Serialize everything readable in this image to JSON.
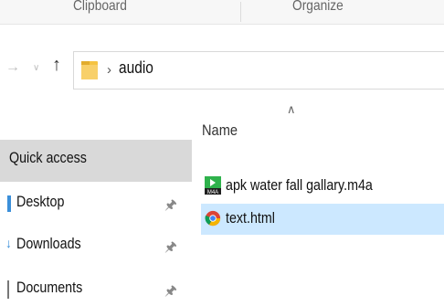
{
  "ribbon": {
    "groups": [
      "Clipboard",
      "Organize"
    ]
  },
  "navigation": {
    "back_icon": "back-arrow-icon",
    "recent_icon": "chevron-down-icon",
    "up_icon": "up-arrow-icon"
  },
  "address_bar": {
    "folder_icon": "folder-icon",
    "breadcrumbs": [
      "audio"
    ]
  },
  "nav_pane": {
    "quick_access_label": "Quick access",
    "items": [
      {
        "label": "Desktop",
        "icon": "desktop-icon",
        "pinned": true
      },
      {
        "label": "Downloads",
        "icon": "downloads-icon",
        "pinned": true
      },
      {
        "label": "Documents",
        "icon": "documents-icon",
        "pinned": true
      }
    ]
  },
  "file_list": {
    "columns": [
      {
        "label": "Name",
        "sort": "ascending"
      }
    ],
    "files": [
      {
        "name": "apk water fall gallary.m4a",
        "icon": "m4a-file-icon",
        "selected": false
      },
      {
        "name": "text.html",
        "icon": "chrome-html-icon",
        "selected": true
      }
    ]
  },
  "colors": {
    "selection": "#cce8ff",
    "quick_access_highlight": "#d9d9d9",
    "folder": "#f5c342"
  }
}
